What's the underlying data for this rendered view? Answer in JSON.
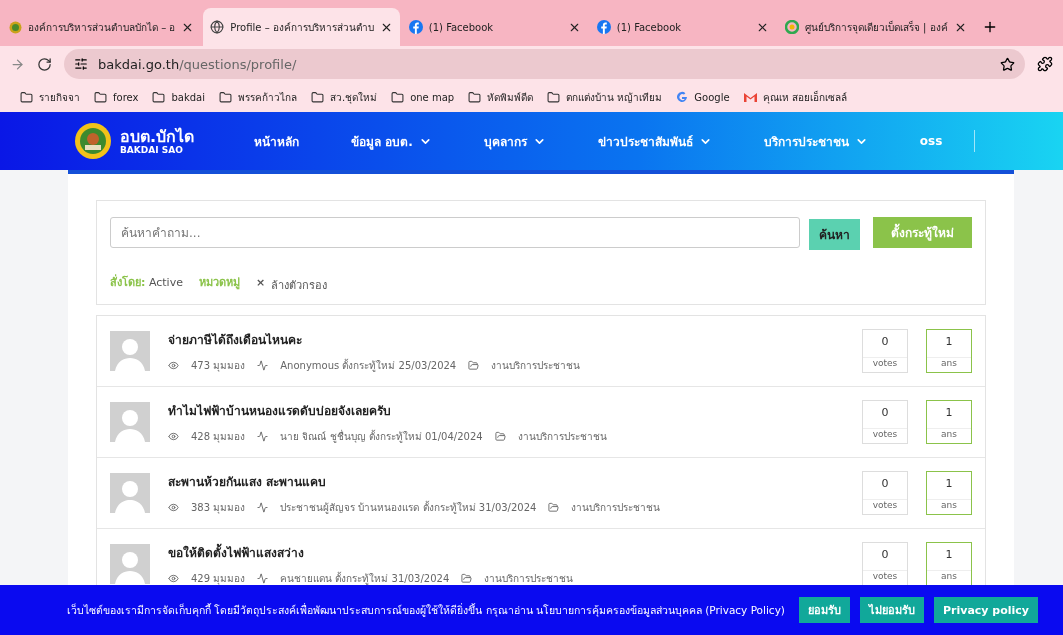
{
  "browser": {
    "tabs": [
      {
        "title": "องค์การบริหารส่วนตำบลบักได – อ",
        "kind": "emblem",
        "selected": false
      },
      {
        "title": "Profile – องค์การบริหารส่วนตำบ",
        "kind": "globe",
        "selected": true
      },
      {
        "title": "(1) Facebook",
        "kind": "facebook",
        "selected": false
      },
      {
        "title": "(1) Facebook",
        "kind": "facebook",
        "selected": false
      },
      {
        "title": "ศูนย์บริการจุดเดียวเบ็ดเสร็จ | องค์",
        "kind": "circle",
        "selected": false
      }
    ],
    "url_host": "bakdai.go.th",
    "url_path": "/questions/profile/",
    "bookmarks": [
      {
        "label": "รายกิจจา",
        "kind": "folder"
      },
      {
        "label": "forex",
        "kind": "folder"
      },
      {
        "label": "bakdai",
        "kind": "folder"
      },
      {
        "label": "พรรคก้าวไกล",
        "kind": "folder"
      },
      {
        "label": "สว.ชุดใหม่",
        "kind": "folder"
      },
      {
        "label": "one map",
        "kind": "folder"
      },
      {
        "label": "หัดพิมพ์ดีด",
        "kind": "folder"
      },
      {
        "label": "ตกแต่งบ้าน หญ้าเทียม",
        "kind": "folder"
      },
      {
        "label": "Google",
        "kind": "google"
      },
      {
        "label": "คุณเห สอยเอ็กเซลล์",
        "kind": "gmail"
      }
    ]
  },
  "site": {
    "logo_title": "อบต.บักได",
    "logo_subtitle": "BAKDAI SAO",
    "nav": [
      {
        "label": "หน้าหลัก",
        "dropdown": false
      },
      {
        "label": "ข้อมูล อบต.",
        "dropdown": true
      },
      {
        "label": "บุคลากร",
        "dropdown": true
      },
      {
        "label": "ข่าวประชาสัมพันธ์",
        "dropdown": true
      },
      {
        "label": "บริการประชาชน",
        "dropdown": true
      },
      {
        "label": "oss",
        "dropdown": false
      }
    ]
  },
  "search": {
    "placeholder": "ค้นหาคำถาม...",
    "search_button": "ค้นหา",
    "new_topic_button": "ตั้งกระทู้ใหม่",
    "sort_label": "สั่งโดย:",
    "sort_value": "Active",
    "category_link": "หมวดหมู่",
    "clear_icon": "×",
    "clear_label": "ล้างตัวกรอง"
  },
  "questions": [
    {
      "title": "จ่ายภาษีได้ถึงเดือนไหนคะ",
      "views": "473 มุมมอง",
      "posted": "Anonymous ตั้งกระทู้ใหม่ 25/03/2024",
      "category": "งานบริการประชาชน",
      "votes": "0",
      "votes_label": "votes",
      "answers": "1",
      "answers_label": "ans"
    },
    {
      "title": "ทำไมไฟฟ้าบ้านหนองแรดดับบ่อยจังเลยครับ",
      "views": "428 มุมมอง",
      "posted": "นาย จิณณ์ ชูชื่นบุญ ตั้งกระทู้ใหม่ 01/04/2024",
      "category": "งานบริการประชาชน",
      "votes": "0",
      "votes_label": "votes",
      "answers": "1",
      "answers_label": "ans"
    },
    {
      "title": "สะพานห้วยกันแสง สะพานแคบ",
      "views": "383 มุมมอง",
      "posted": "ประชาชนผู้สัญจร บ้านหนองแรด ตั้งกระทู้ใหม่ 31/03/2024",
      "category": "งานบริการประชาชน",
      "votes": "0",
      "votes_label": "votes",
      "answers": "1",
      "answers_label": "ans"
    },
    {
      "title": "ขอให้ติดตั้งไฟฟ้าแสงสว่าง",
      "views": "429 มุมมอง",
      "posted": "คนชายแดน ตั้งกระทู้ใหม่ 31/03/2024",
      "category": "งานบริการประชาชน",
      "votes": "0",
      "votes_label": "votes",
      "answers": "1",
      "answers_label": "ans"
    }
  ],
  "cookie_banner": {
    "text": "เว็บไซต์ของเรามีการจัดเก็บคุกกี้ โดยมีวัตถุประสงค์เพื่อพัฒนาประสบการณ์ของผู้ใช้ให้ดียิ่งขึ้น กรุณาอ่าน นโยบายการคุ้มครองข้อมูลส่วนบุคคล (Privacy Policy)",
    "accept": "ยอมรับ",
    "decline": "ไม่ยอมรับ",
    "policy": "Privacy policy"
  }
}
